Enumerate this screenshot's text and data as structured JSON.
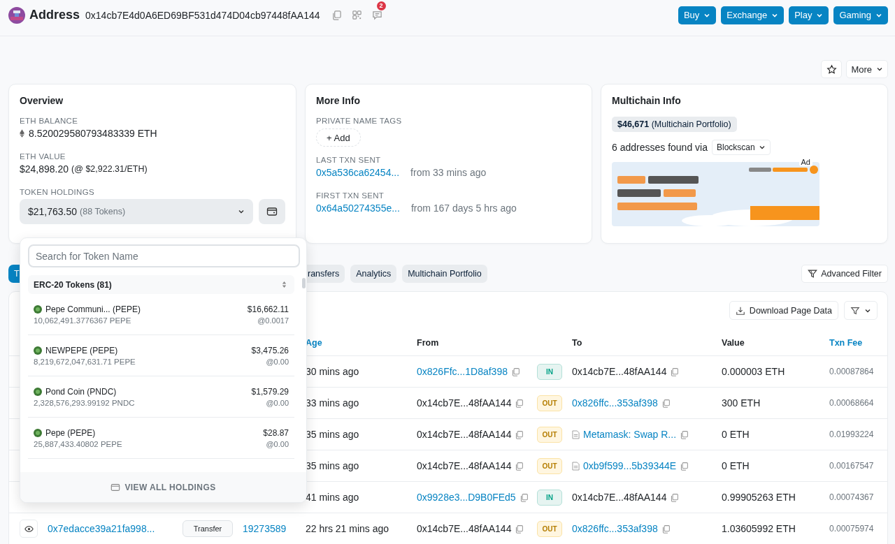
{
  "header": {
    "title": "Address",
    "address": "0x14cb7E4d0A6ED69BF531d474D04cb97448fAA144",
    "notification_count": "2",
    "menus": [
      "Buy",
      "Exchange",
      "Play",
      "Gaming"
    ]
  },
  "more_button": "More",
  "overview": {
    "title": "Overview",
    "eth_balance_label": "ETH BALANCE",
    "eth_balance": "8.520029580793483339 ETH",
    "eth_value_label": "ETH VALUE",
    "eth_value": "$24,898.20",
    "eth_price": "(@ $2,922.31/ETH)",
    "token_holdings_label": "TOKEN HOLDINGS",
    "token_total": "$21,763.50",
    "token_count": "(88 Tokens)"
  },
  "more_info": {
    "title": "More Info",
    "name_tags_label": "PRIVATE NAME TAGS",
    "add_button": "+ Add",
    "last_txn_label": "LAST TXN SENT",
    "last_txn_hash": "0x5a536ca62454...",
    "last_txn_time": "from 33 mins ago",
    "first_txn_label": "FIRST TXN SENT",
    "first_txn_hash": "0x64a50274355e...",
    "first_txn_time": "from 167 days 5 hrs ago"
  },
  "multichain": {
    "title": "Multichain Info",
    "portfolio": "**$46,671** (Multichain Portfolio)",
    "found_text": "6 addresses found via",
    "source": "Blockscan",
    "ad_label": "Ad"
  },
  "token_dropdown": {
    "search_placeholder": "Search for Token Name",
    "group": "ERC-20 Tokens (81)",
    "tokens": [
      {
        "name": "Pepe Communi... (PEPE)",
        "amount": "10,062,491.3776367 PEPE",
        "value": "$16,662.11",
        "price": "@0.0017"
      },
      {
        "name": "NEWPEPE (PEPE)",
        "amount": "8,219,672,047,631.71 PEPE",
        "value": "$3,475.26",
        "price": "@0.00"
      },
      {
        "name": "Pond Coin (PNDC)",
        "amount": "2,328,576,293.99192 PNDC",
        "value": "$1,579.29",
        "price": "@0.00"
      },
      {
        "name": "Pepe (PEPE)",
        "amount": "25,887,433.40802 PEPE",
        "value": "$28.87",
        "price": "@0.00"
      }
    ],
    "view_all": "VIEW ALL HOLDINGS"
  },
  "tabs": [
    {
      "label": "T",
      "selected": true
    },
    {
      "label": "ransfers",
      "selected": false
    },
    {
      "label": "Analytics",
      "selected": false
    },
    {
      "label": "Multichain Portfolio",
      "selected": false
    }
  ],
  "advanced_filter": "Advanced Filter",
  "table": {
    "download": "Download Page Data",
    "columns": [
      {
        "label": "Age",
        "link": true
      },
      {
        "label": "From",
        "link": false
      },
      {
        "label": "To",
        "link": false
      },
      {
        "label": "Value",
        "link": false
      },
      {
        "label": "Txn Fee",
        "link": true
      }
    ],
    "rows": [
      {
        "age": "30 mins ago",
        "from": "0x826Ffc...1D8af398",
        "from_link": true,
        "direction": {
          "label": "IN",
          "kind": "in"
        },
        "to": "0x14cb7E...48fAA144",
        "to_link": false,
        "to_contract": false,
        "value": "0.000003 ETH",
        "fee": "0.00087864"
      },
      {
        "age": "33 mins ago",
        "from": "0x14cb7E...48fAA144",
        "from_link": false,
        "direction": {
          "label": "OUT",
          "kind": "out"
        },
        "to": "0x826ffc...353af398",
        "to_link": true,
        "to_contract": false,
        "value": "300 ETH",
        "fee": "0.00068664"
      },
      {
        "age": "35 mins ago",
        "from": "0x14cb7E...48fAA144",
        "from_link": false,
        "direction": {
          "label": "OUT",
          "kind": "out"
        },
        "to": "Metamask: Swap R...",
        "to_link": true,
        "to_contract": true,
        "value": "0 ETH",
        "fee": "0.01993224"
      },
      {
        "age": "35 mins ago",
        "from": "0x14cb7E...48fAA144",
        "from_link": false,
        "direction": {
          "label": "OUT",
          "kind": "out"
        },
        "to": "0xb9f599...5b39344E",
        "to_link": true,
        "to_contract": true,
        "value": "0 ETH",
        "fee": "0.00167547"
      },
      {
        "age": "41 mins ago",
        "from": "0x9928e3...D9B0FEd5",
        "from_link": true,
        "direction": {
          "label": "IN",
          "kind": "in"
        },
        "to": "0x14cb7E...48fAA144",
        "to_link": false,
        "to_contract": false,
        "value": "0.99905263 ETH",
        "fee": "0.00074367"
      },
      {
        "hash": "0x7edacce39a21fa998...",
        "method": "Transfer",
        "block": "19273589",
        "age": "22 hrs 21 mins ago",
        "from": "0x14cb7E...48fAA144",
        "from_link": false,
        "direction": {
          "label": "OUT",
          "kind": "out"
        },
        "to": "0x826ffc...353af398",
        "to_link": true,
        "to_contract": false,
        "value": "1.03605992 ETH",
        "fee": "0.00075974"
      }
    ]
  }
}
